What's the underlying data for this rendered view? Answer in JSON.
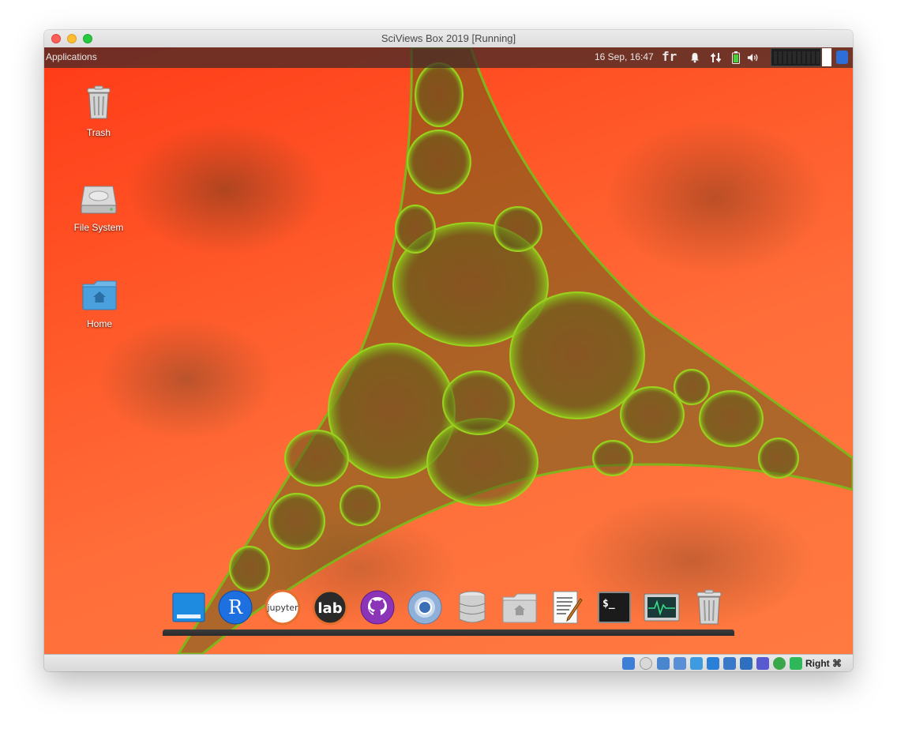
{
  "window": {
    "title": "SciViews Box 2019 [Running]"
  },
  "topbar": {
    "applications_label": "Applications",
    "clock": "16 Sep, 16:47",
    "keyboard_layout": "fr"
  },
  "desktop_icons": [
    {
      "name": "trash",
      "label": "Trash"
    },
    {
      "name": "file-system",
      "label": "File System"
    },
    {
      "name": "home",
      "label": "Home"
    }
  ],
  "dock": {
    "items": [
      {
        "name": "desktop-launcher",
        "icon": "desktop-icon"
      },
      {
        "name": "r-launcher",
        "icon": "r-logo-icon",
        "text": "R"
      },
      {
        "name": "jupyter-launcher",
        "icon": "jupyter-logo-icon",
        "text": "jupyter"
      },
      {
        "name": "jupyterlab-launcher",
        "icon": "jupyterlab-logo-icon",
        "text": "lab"
      },
      {
        "name": "github-launcher",
        "icon": "github-icon"
      },
      {
        "name": "chromium-launcher",
        "icon": "chromium-icon"
      },
      {
        "name": "database-launcher",
        "icon": "database-icon"
      },
      {
        "name": "home-folder-launcher",
        "icon": "home-folder-icon"
      },
      {
        "name": "text-editor-launcher",
        "icon": "text-editor-icon"
      },
      {
        "name": "terminal-launcher",
        "icon": "terminal-icon",
        "text": "$_"
      },
      {
        "name": "system-monitor-launcher",
        "icon": "system-monitor-icon"
      },
      {
        "name": "trash-launcher",
        "icon": "trash-icon"
      }
    ]
  },
  "vbox_status": {
    "host_key_label": "Right ⌘"
  }
}
